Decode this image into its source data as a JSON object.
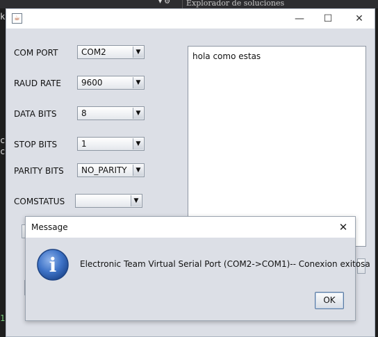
{
  "ide": {
    "explorer_title": "Explorador de soluciones",
    "controls_glyph": "▾ ⚙",
    "gutter_fragments": [
      "k",
      "co",
      "cs",
      "1"
    ]
  },
  "app": {
    "controls": {
      "minimize": "—",
      "maximize": "☐",
      "close": "✕"
    },
    "fields": [
      {
        "label": "COM PORT",
        "value": "COM2"
      },
      {
        "label": "RAUD RATE",
        "value": "9600"
      },
      {
        "label": "DATA BITS",
        "value": "8"
      },
      {
        "label": "STOP BITS",
        "value": "1"
      },
      {
        "label": "PARITY BITS",
        "value": "NO_PARITY"
      },
      {
        "label": "COMSTATUS",
        "value": ""
      }
    ],
    "received_text": "hola como estas"
  },
  "dialog": {
    "title": "Message",
    "close_glyph": "✕",
    "message": "Electronic Team Virtual Serial Port (COM2->COM1)-- Conexion exitosa",
    "ok_label": "OK",
    "icon": "info-icon",
    "icon_letter": "i",
    "icon_color": "#2e63b8"
  }
}
